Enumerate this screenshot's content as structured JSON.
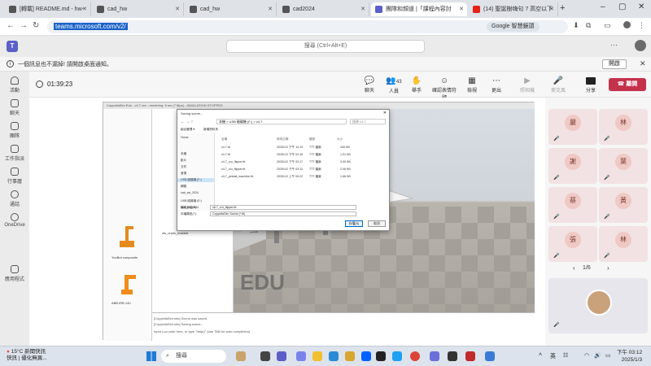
{
  "browser": {
    "tabs": [
      {
        "label": "[轉載] README.md - hw-"
      },
      {
        "label": "cad_hw"
      },
      {
        "label": "cad_hw"
      },
      {
        "label": "cad2024"
      },
      {
        "label": "團隊和頻道 |「課程內容討"
      },
      {
        "label": "(14) 聖誕樹嗨句 7 高空以下"
      }
    ],
    "url": "teams.microsoft.com/v2/",
    "google_pill": "Google 智慧鏡頭"
  },
  "teams": {
    "search_placeholder": "搜尋 (Ctrl+Alt+E)",
    "more": "···"
  },
  "notification": {
    "text": "一個訊息也不漏掉! 請開啟桌面通知。",
    "button": "開啟"
  },
  "rail": [
    {
      "label": "活動",
      "icon": "bell-icon"
    },
    {
      "label": "聊天",
      "icon": "chat-icon"
    },
    {
      "label": "團隊",
      "icon": "teams-icon"
    },
    {
      "label": "工作指派",
      "icon": "assignments-icon"
    },
    {
      "label": "行事曆",
      "icon": "calendar-icon"
    },
    {
      "label": "通話",
      "icon": "phone-icon"
    },
    {
      "label": "OneDrive",
      "icon": "onedrive-icon"
    },
    {
      "label": "應用程式",
      "icon": "apps-icon"
    }
  ],
  "meeting": {
    "timer": "01:39:23",
    "controls": [
      {
        "label": "聊天",
        "glyph": "💬",
        "on": true
      },
      {
        "label": "人員",
        "glyph": "👥",
        "on": true,
        "badge": "43"
      },
      {
        "label": "舉手",
        "glyph": "✋",
        "on": true
      },
      {
        "label": "確認表情符號",
        "glyph": "☺",
        "on": true
      },
      {
        "label": "檢視",
        "glyph": "▦",
        "on": true
      },
      {
        "label": "更出",
        "glyph": "⋯",
        "on": true
      },
      {
        "label": "照相機",
        "glyph": "▶",
        "on": false
      },
      {
        "label": "麥克風",
        "glyph": "🎤",
        "on": false
      },
      {
        "label": "分享",
        "glyph": "⬆",
        "on": true
      }
    ],
    "leave": "離開"
  },
  "shared_screen": {
    "window_title": "CoppeliaSim Edu - v4.7-rev - rendering: 9 ms (7.9fps) - SIMULATION STOPPED",
    "viewport_label": "ufo.view",
    "edu_watermark": "EDU",
    "library_items": [
      "YouBot composite",
      "ABB IRB 140"
    ],
    "tree_item": "cts_chain_bracket",
    "console_lines": [
      "[CoppeliaSim:info]   Scene was saved.",
      "[CoppeliaSim:info]   Saving scene...",
      "Input Lua code here, or type \"help()\" (use TAB for auto-completion)"
    ],
    "dialog": {
      "title": "Saving scene...",
      "path": "本機 > USB 磁碟機 (F:) > v4.7",
      "search": "搜尋 v4.7",
      "toolbar": [
        "組合管理 ▾",
        "新增資料夾"
      ],
      "nav": [
        "Home",
        "本機",
        "影片",
        "文件",
        "音樂",
        "USB 磁碟機 (F:)",
        "網路",
        "cad_ws_2024",
        "USB 磁碟機 (E:)",
        "cad_ws_2024"
      ],
      "columns": [
        "名稱",
        "修改日期",
        "類型",
        "大小"
      ],
      "rows": [
        {
          "name": "v4.7.ttt",
          "date": "2025/1/2 下午 12:13",
          "type": "TTT 檔案",
          "size": "449 KB"
        },
        {
          "name": "v4.7.ttt",
          "date": "2025/1/2 下午 02:16",
          "type": "TTT 檔案",
          "size": "1.01 KB"
        },
        {
          "name": "v4.7_cru_flipper.ttt",
          "date": "2025/1/2 下午 02:17",
          "type": "TTT 檔案",
          "size": "3.00 KB"
        },
        {
          "name": "v4.7_cru_flipper.ttt",
          "date": "2025/1/2 下午 03:12",
          "type": "TTT 檔案",
          "size": "2.06 KB"
        },
        {
          "name": "v4.7_pinball_machine.ttt",
          "date": "2025/1/2 上午 09:22",
          "type": "TTT 檔案",
          "size": "1.66 KB"
        }
      ],
      "filename_label": "檔案名稱(N):",
      "filename": "v4.7_cru_flipper.ttt",
      "filetype_label": "存檔類型(T):",
      "filetype": "CoppeliaSim Scene (*.ttt)",
      "save": "存檔(S)",
      "cancel": "取消"
    }
  },
  "participants": [
    {
      "initial": "嚴"
    },
    {
      "initial": "林"
    },
    {
      "initial": "謝"
    },
    {
      "initial": "葉"
    },
    {
      "initial": "蔡"
    },
    {
      "initial": "黃"
    },
    {
      "initial": "張"
    },
    {
      "initial": "林"
    }
  ],
  "pager": "1/6",
  "taskbar": {
    "weather_temp": "15°C",
    "weather_title": "新聞快訊",
    "weather_sub": "快訊 | 優化無異...",
    "search": "搜尋",
    "lang": "英",
    "time": "下午 03:12",
    "date": "2025/1/3"
  },
  "colors": {
    "teams_purple": "#5b5fc7",
    "leave_red": "#c4314b",
    "url_highlight": "#1a61c8"
  }
}
